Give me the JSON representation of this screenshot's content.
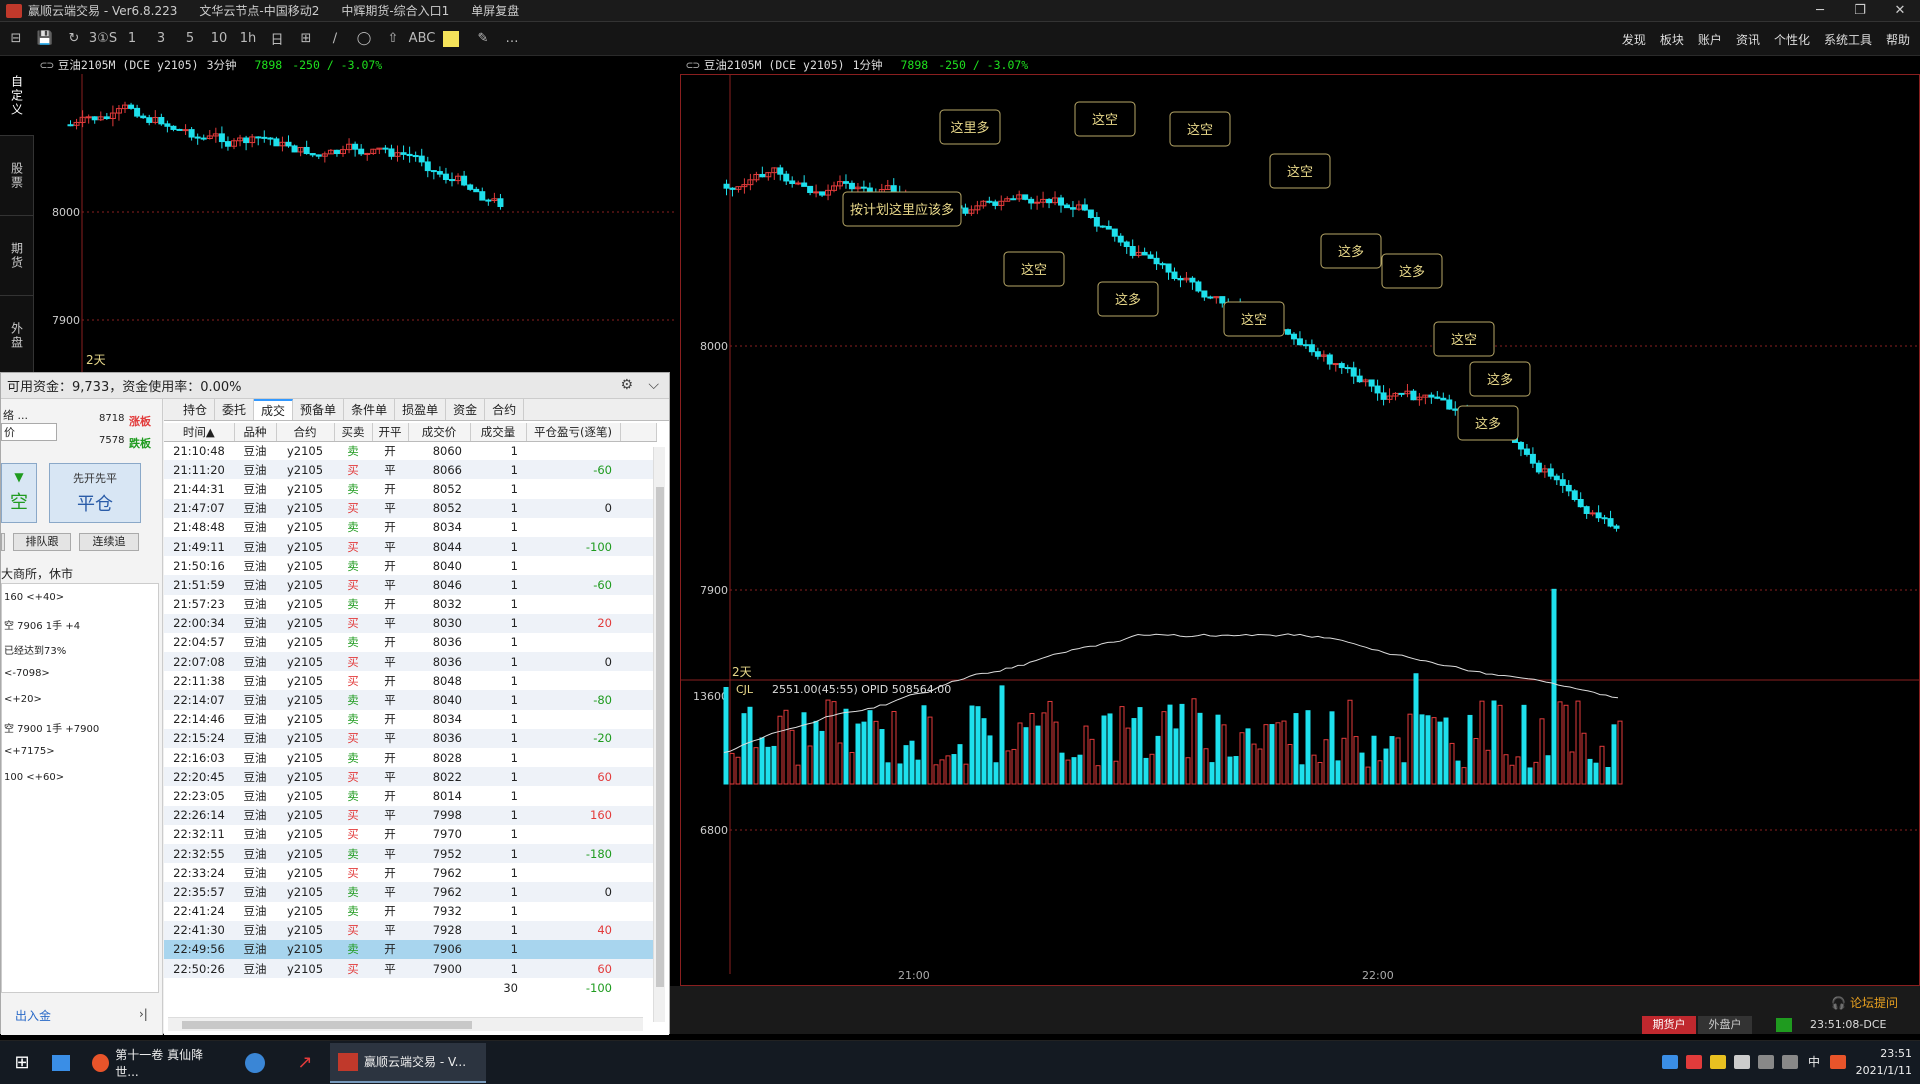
{
  "titlebar": {
    "app": "赢顺云端交易  -  Ver6.8.223",
    "server": "文华云节点-中国移动2",
    "broker": "中辉期货-综合入口1",
    "mode": "单屏复盘",
    "minimize": "─",
    "restore": "❐",
    "close": "✕"
  },
  "toolbar": {
    "tools": [
      "⊟",
      "💾",
      "↻",
      "3①S",
      "1",
      "3",
      "5",
      "10",
      "1h",
      "日",
      "⊞",
      "∕",
      "◯",
      "⇧",
      "ABC",
      "",
      "✎",
      "…"
    ],
    "menu": [
      "发现",
      "板块",
      "账户",
      "资讯",
      "个性化",
      "系统工具",
      "帮助"
    ]
  },
  "sidetabs": [
    "自定义",
    "股票",
    "期货",
    "外盘"
  ],
  "left_chart": {
    "symbol": "豆油2105M (DCE y2105)",
    "period": "3分钟",
    "price": "7898",
    "change": "-250 / -3.07%",
    "days_label": "2天",
    "y_ticks": [
      "8000",
      "7900"
    ]
  },
  "right_chart": {
    "symbol": "豆油2105M (DCE y2105)",
    "period": "1分钟",
    "price": "7898",
    "change": "-250 / -3.07%",
    "days_label": "2天",
    "y_ticks": [
      "8000",
      "7900"
    ],
    "x_ticks": [
      "21:00",
      "22:00"
    ],
    "volume_ticks": [
      "13600",
      "6800"
    ],
    "volume_header": "CJL",
    "volume_info": "2551.00(45:55)  OPID 508564.00",
    "annotations": [
      {
        "text": "按计划这里应该多"
      },
      {
        "text": "这里多"
      },
      {
        "text": "这空"
      },
      {
        "text": "这空"
      },
      {
        "text": "这空"
      },
      {
        "text": "这空"
      },
      {
        "text": "这多"
      },
      {
        "text": "这空"
      },
      {
        "text": "这多"
      },
      {
        "text": "这多"
      },
      {
        "text": "这空"
      },
      {
        "text": "这多"
      },
      {
        "text": "这多"
      }
    ]
  },
  "trade_panel": {
    "funds": "可用资金：9,733，资金使用率：0.00%",
    "tabs": [
      "持仓",
      "委托",
      "成交",
      "预备单",
      "条件单",
      "损盈单",
      "资金",
      "合约"
    ],
    "active_tab": "成交",
    "columns": [
      "时间▲",
      "品种",
      "合约",
      "买卖",
      "开平",
      "成交价",
      "成交量",
      "平仓盈亏(逐笔)"
    ],
    "rows": [
      [
        "21:10:48",
        "豆油",
        "y2105",
        "卖",
        "开",
        "8060",
        "1",
        ""
      ],
      [
        "21:11:20",
        "豆油",
        "y2105",
        "买",
        "平",
        "8066",
        "1",
        "-60"
      ],
      [
        "21:44:31",
        "豆油",
        "y2105",
        "卖",
        "开",
        "8052",
        "1",
        ""
      ],
      [
        "21:47:07",
        "豆油",
        "y2105",
        "买",
        "平",
        "8052",
        "1",
        "0"
      ],
      [
        "21:48:48",
        "豆油",
        "y2105",
        "卖",
        "开",
        "8034",
        "1",
        ""
      ],
      [
        "21:49:11",
        "豆油",
        "y2105",
        "买",
        "平",
        "8044",
        "1",
        "-100"
      ],
      [
        "21:50:16",
        "豆油",
        "y2105",
        "卖",
        "开",
        "8040",
        "1",
        ""
      ],
      [
        "21:51:59",
        "豆油",
        "y2105",
        "买",
        "平",
        "8046",
        "1",
        "-60"
      ],
      [
        "21:57:23",
        "豆油",
        "y2105",
        "卖",
        "开",
        "8032",
        "1",
        ""
      ],
      [
        "22:00:34",
        "豆油",
        "y2105",
        "买",
        "平",
        "8030",
        "1",
        "20"
      ],
      [
        "22:04:57",
        "豆油",
        "y2105",
        "卖",
        "开",
        "8036",
        "1",
        ""
      ],
      [
        "22:07:08",
        "豆油",
        "y2105",
        "买",
        "平",
        "8036",
        "1",
        "0"
      ],
      [
        "22:11:38",
        "豆油",
        "y2105",
        "买",
        "开",
        "8048",
        "1",
        ""
      ],
      [
        "22:14:07",
        "豆油",
        "y2105",
        "卖",
        "平",
        "8040",
        "1",
        "-80"
      ],
      [
        "22:14:46",
        "豆油",
        "y2105",
        "卖",
        "开",
        "8034",
        "1",
        ""
      ],
      [
        "22:15:24",
        "豆油",
        "y2105",
        "买",
        "平",
        "8036",
        "1",
        "-20"
      ],
      [
        "22:16:03",
        "豆油",
        "y2105",
        "卖",
        "开",
        "8028",
        "1",
        ""
      ],
      [
        "22:20:45",
        "豆油",
        "y2105",
        "买",
        "平",
        "8022",
        "1",
        "60"
      ],
      [
        "22:23:05",
        "豆油",
        "y2105",
        "卖",
        "开",
        "8014",
        "1",
        ""
      ],
      [
        "22:26:14",
        "豆油",
        "y2105",
        "买",
        "平",
        "7998",
        "1",
        "160"
      ],
      [
        "22:32:11",
        "豆油",
        "y2105",
        "买",
        "开",
        "7970",
        "1",
        ""
      ],
      [
        "22:32:55",
        "豆油",
        "y2105",
        "卖",
        "平",
        "7952",
        "1",
        "-180"
      ],
      [
        "22:33:24",
        "豆油",
        "y2105",
        "买",
        "开",
        "7962",
        "1",
        ""
      ],
      [
        "22:35:57",
        "豆油",
        "y2105",
        "卖",
        "平",
        "7962",
        "1",
        "0"
      ],
      [
        "22:41:24",
        "豆油",
        "y2105",
        "卖",
        "开",
        "7932",
        "1",
        ""
      ],
      [
        "22:41:30",
        "豆油",
        "y2105",
        "买",
        "平",
        "7928",
        "1",
        "40"
      ],
      [
        "22:49:56",
        "豆油",
        "y2105",
        "卖",
        "开",
        "7906",
        "1",
        ""
      ],
      [
        "22:50:26",
        "豆油",
        "y2105",
        "买",
        "平",
        "7900",
        "1",
        "60"
      ],
      [
        "",
        "",
        "",
        "",
        "",
        "",
        "30",
        "-100"
      ]
    ],
    "selected_row": 26,
    "left": {
      "order_label": "络 ...",
      "price_label": "价",
      "limit_up": "8718",
      "limit_up_label": "涨板",
      "limit_down": "7578",
      "limit_down_label": "跌板",
      "dir_arrow": "▼",
      "dir_text": "空",
      "close_first": "先开先平",
      "close_btn": "平仓",
      "queue_btn": "排队跟",
      "chase_btn": "连续追",
      "status": "大商所，休市",
      "log": [
        "160 <+40>",
        "空 7906 1手 +4",
        "已经达到73%",
        "<-7098>",
        "<+20>",
        "空 7900 1手 +7900",
        "<+7175>",
        "100 <+60>"
      ],
      "funds_link": "出入金",
      "collapse": "›|"
    }
  },
  "status": {
    "forum": "论坛提问",
    "acct1": "期货户",
    "acct2": "外盘户",
    "time": "23:51:08-DCE"
  },
  "taskbar": {
    "items": [
      "第十一卷 真仙降世...",
      "",
      "",
      "赢顺云端交易  -  V..."
    ],
    "clock_time": "23:51",
    "clock_date": "2021/1/11",
    "ime": "中"
  },
  "colors": {
    "up": "#e23b3b",
    "down": "#1ee0ec",
    "annotation": "#e8d88a",
    "gridline": "#8a1f1f",
    "bg": "#000000"
  }
}
